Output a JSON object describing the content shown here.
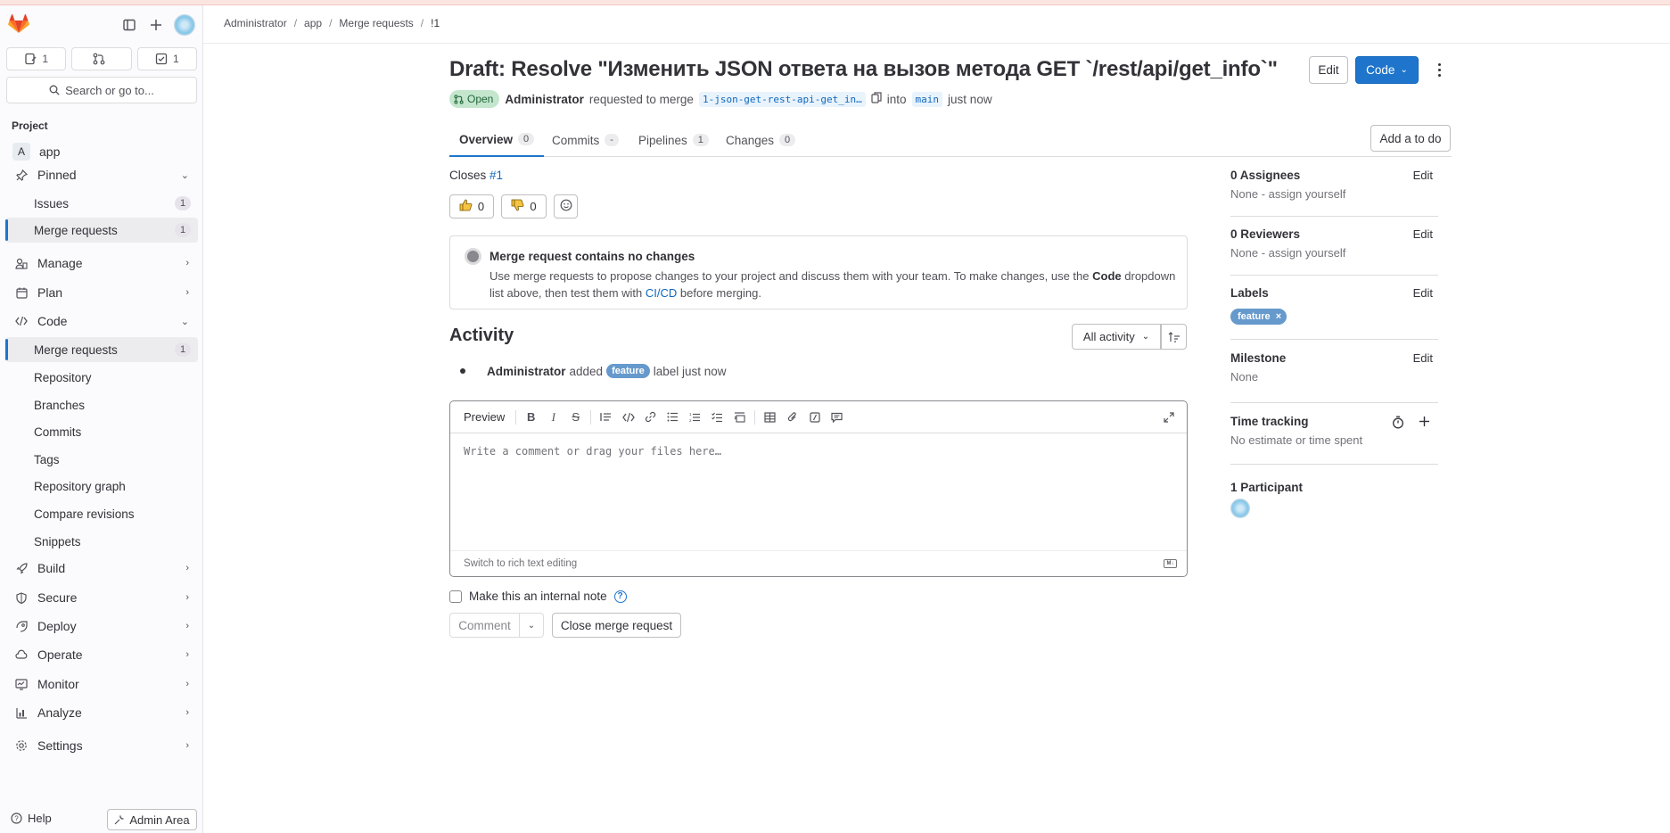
{
  "breadcrumb": [
    "Administrator",
    "app",
    "Merge requests",
    "!1"
  ],
  "sidebar": {
    "counts": [
      {
        "icon": "issues-icon",
        "value": "1"
      },
      {
        "icon": "merge-request-icon",
        "value": ""
      },
      {
        "icon": "todo-icon",
        "value": "1"
      }
    ],
    "search_label": "Search or go to...",
    "section_label": "Project",
    "project_initial": "A",
    "project_name": "app",
    "pinned_label": "Pinned",
    "pinned_items": [
      {
        "label": "Issues",
        "count": "1"
      },
      {
        "label": "Merge requests",
        "count": "1"
      }
    ],
    "manage_label": "Manage",
    "plan_label": "Plan",
    "code_label": "Code",
    "code_items": [
      {
        "label": "Merge requests",
        "count": "1"
      },
      {
        "label": "Repository"
      },
      {
        "label": "Branches"
      },
      {
        "label": "Commits"
      },
      {
        "label": "Tags"
      },
      {
        "label": "Repository graph"
      },
      {
        "label": "Compare revisions"
      },
      {
        "label": "Snippets"
      }
    ],
    "build_label": "Build",
    "secure_label": "Secure",
    "deploy_label": "Deploy",
    "operate_label": "Operate",
    "monitor_label": "Monitor",
    "analyze_label": "Analyze",
    "settings_label": "Settings",
    "help_label": "Help",
    "admin_label": "Admin Area"
  },
  "mr": {
    "title": "Draft: Resolve \"Изменить JSON ответа на вызов метода GET `/rest/api/get_info`\"",
    "edit_label": "Edit",
    "code_label": "Code",
    "status": "Open",
    "author": "Administrator",
    "requested_text": "requested to merge",
    "source_branch": "1-json-get-rest-api-get_in…",
    "into_text": "into",
    "target_branch": "main",
    "time": "just now",
    "tabs": [
      {
        "label": "Overview",
        "count": "0"
      },
      {
        "label": "Commits",
        "count": "-"
      },
      {
        "label": "Pipelines",
        "count": "1"
      },
      {
        "label": "Changes",
        "count": "0"
      }
    ],
    "todo_label": "Add a to do",
    "closes_label": "Closes",
    "closes_ref": "#1",
    "thumbs_up": "0",
    "thumbs_down": "0",
    "empty_title": "Merge request contains no changes",
    "empty_text_1": "Use merge requests to propose changes to your project and discuss them with your team. To make changes, use the",
    "empty_code": "Code",
    "empty_text_2": "dropdown list above, then test them with",
    "empty_link": "CI/CD",
    "empty_text_3": "before merging."
  },
  "activity": {
    "heading": "Activity",
    "filter_label": "All activity",
    "note_author": "Administrator",
    "note_action": "added",
    "note_label": "feature",
    "note_suffix": "label just now"
  },
  "editor": {
    "preview_label": "Preview",
    "placeholder": "Write a comment or drag your files here…",
    "switch_label": "Switch to rich text editing",
    "internal_label": "Make this an internal note",
    "comment_label": "Comment",
    "close_label": "Close merge request"
  },
  "right": {
    "assignees_title": "0 Assignees",
    "assignees_value": "None - assign yourself",
    "reviewers_title": "0 Reviewers",
    "reviewers_value": "None - assign yourself",
    "labels_title": "Labels",
    "label_name": "feature",
    "milestone_title": "Milestone",
    "milestone_value": "None",
    "time_title": "Time tracking",
    "time_value": "No estimate or time spent",
    "participants_title": "1 Participant",
    "edit_label": "Edit"
  },
  "colors": {
    "primary": "#1f75cb",
    "label": "#6699cc",
    "open_badge": "#c3e6cd"
  }
}
